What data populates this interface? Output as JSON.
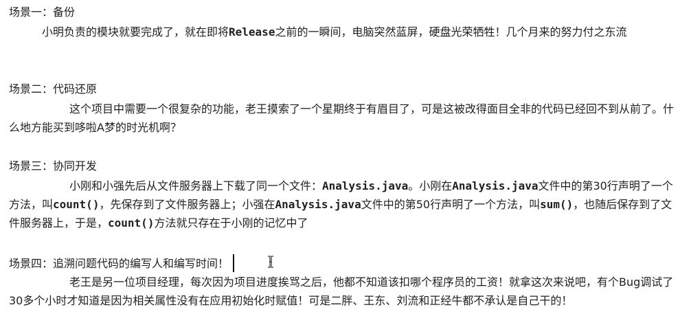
{
  "scenes": [
    {
      "title": "场景一：备份",
      "body_parts": [
        "小明负责的模块就要完成了，就在即将",
        "Release",
        "之前的一瞬间，电脑突然蓝屏，硬盘光荣牺牲！几个月来的努力付之东流"
      ]
    },
    {
      "title": "场景二：代码还原",
      "body_parts": [
        "这个项目中需要一个很复杂的功能，老王摸索了一个星期终于有眉目了，可是这被改得面目全非的代码已经回不到从前了。什么地方能买到哆啦A梦的时光机啊？"
      ]
    },
    {
      "title": "场景三：协同开发",
      "body_parts": [
        "小刚和小强先后从文件服务器上下载了同一个文件：",
        "Analysis.java",
        "。小刚在",
        "Analysis.java",
        "文件中的第30行声明了一个方法，叫",
        "count()",
        "，先保存到了文件服务器上；小强在",
        "Analysis.java",
        "文件中的第50行声明了一个方法，叫",
        "sum()",
        "，也随后保存到了文件服务器上，于是，",
        "count()",
        "方法就只存在于小刚的记忆中了"
      ]
    },
    {
      "title": "场景四：追溯问题代码的编写人和编写时间！",
      "body_parts": [
        "老王是另一位项目经理，每次因为项目进度挨骂之后，他都不知道该扣哪个程序员的工资！就拿这次来说吧，有个Bug调试了30多个小时才知道是因为相关属性没有在应用初始化时赋值！可是二胖、王东、刘流和正经牛都不承认是自己干的！"
      ]
    }
  ]
}
